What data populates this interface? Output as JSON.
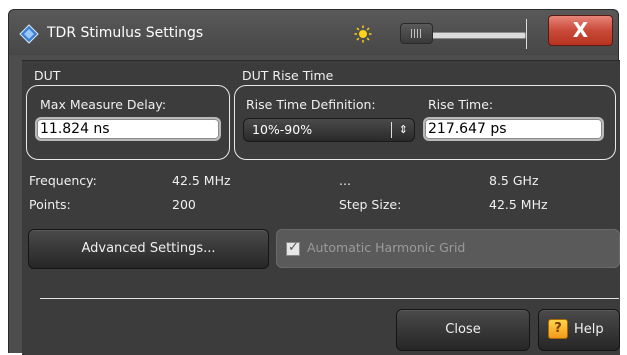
{
  "window": {
    "title": "TDR Stimulus Settings",
    "close_label": "X"
  },
  "dut": {
    "group_label": "DUT",
    "max_delay_label": "Max Measure Delay:",
    "max_delay_value": "11.824 ns"
  },
  "rise": {
    "group_label": "DUT Rise Time",
    "definition_label": "Rise Time Definition:",
    "definition_value": "10%-90%",
    "rise_time_label": "Rise Time:",
    "rise_time_value": "217.647 ps"
  },
  "info": {
    "frequency_label": "Frequency:",
    "frequency_start": "42.5 MHz",
    "range_sep": "...",
    "frequency_stop": "8.5 GHz",
    "points_label": "Points:",
    "points_value": "200",
    "step_label": "Step Size:",
    "step_value": "42.5 MHz"
  },
  "buttons": {
    "advanced": "Advanced Settings...",
    "harmonic_grid": "Automatic Harmonic Grid",
    "harmonic_grid_checked": true,
    "close": "Close",
    "help": "Help",
    "help_glyph": "?"
  },
  "colors": {
    "background": "#3c3c3c",
    "titlebar": "#4d4d4d",
    "close_button": "#c94a3a",
    "help_icon": "#f5b51a"
  }
}
